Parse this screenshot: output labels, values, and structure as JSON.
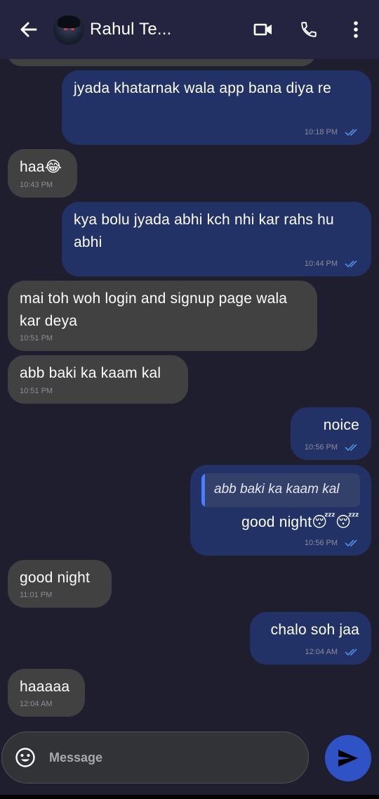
{
  "header": {
    "contact_name": "Rahul Te...",
    "icons": [
      "back-arrow-icon",
      "video-camera-icon",
      "phone-icon",
      "more-vertical-icon"
    ]
  },
  "messages": [
    {
      "direction": "out",
      "text": "jyada khatarnak wala app bana diya re",
      "time": "10:18 PM",
      "status": "read"
    },
    {
      "direction": "in",
      "text": "haa😂",
      "time": "10:43 PM"
    },
    {
      "direction": "out",
      "text": "kya bolu jyada abhi kch nhi kar rahs hu abhi",
      "time": "10:44 PM",
      "status": "read"
    },
    {
      "direction": "in",
      "text": "mai toh woh login and signup page wala kar deya",
      "time": "10:51 PM"
    },
    {
      "direction": "in",
      "text": "abb baki ka kaam kal",
      "time": "10:51 PM"
    },
    {
      "direction": "out",
      "text": "noice",
      "time": "10:56 PM",
      "status": "read"
    },
    {
      "direction": "out",
      "reply_to": "abb baki ka kaam kal",
      "text": "good night😴😴",
      "time": "10:56 PM",
      "status": "read"
    },
    {
      "direction": "in",
      "text": "good night",
      "time": "11:01 PM"
    },
    {
      "direction": "out",
      "text": "chalo soh jaa",
      "time": "12:04 AM",
      "status": "read"
    },
    {
      "direction": "in",
      "text": "haaaaa",
      "time": "12:04 AM"
    }
  ],
  "composer": {
    "placeholder": "Message",
    "value": ""
  },
  "colors": {
    "background": "#1e1e2e",
    "header": "#252440",
    "incoming_bubble": "#414141",
    "outgoing_bubble": "#223266",
    "read_ticks": "#4f8fe8",
    "send_button": "#2f53c6"
  }
}
